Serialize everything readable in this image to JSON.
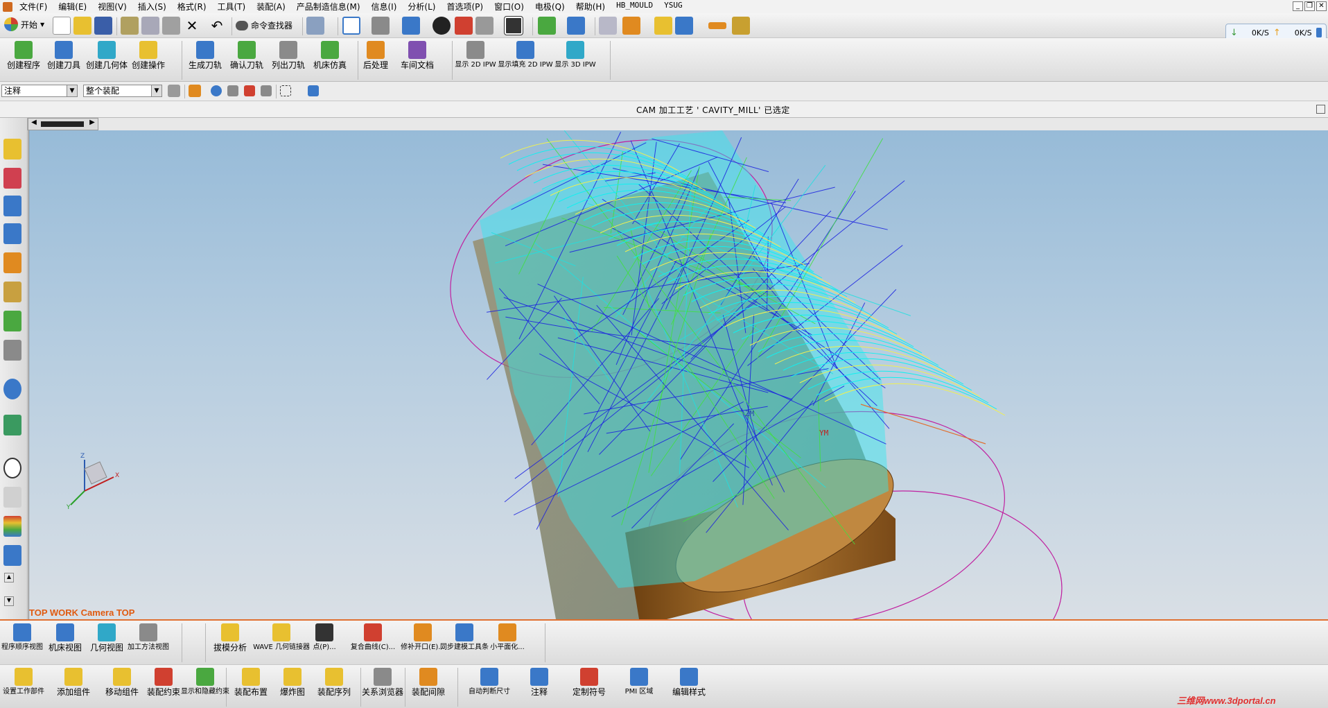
{
  "menu": [
    "文件(F)",
    "编辑(E)",
    "视图(V)",
    "插入(S)",
    "格式(R)",
    "工具(T)",
    "装配(A)",
    "产品制造信息(M)",
    "信息(I)",
    "分析(L)",
    "首选项(P)",
    "窗口(O)",
    "电极(Q)",
    "帮助(H)",
    "HB_MOULD",
    "YSUG"
  ],
  "toolbar1": {
    "start": "开始",
    "command_finder": "命令查找器"
  },
  "network": {
    "down": "0K/S",
    "up": "0K/S"
  },
  "toolbar2": [
    {
      "label": "创建程序",
      "icon": "create-program-icon",
      "color": "#4aa840"
    },
    {
      "label": "创建刀具",
      "icon": "create-tool-icon",
      "color": "#3a78c8"
    },
    {
      "label": "创建几何体",
      "icon": "create-geometry-icon",
      "color": "#30a8c8"
    },
    {
      "label": "创建操作",
      "icon": "create-operation-icon",
      "color": "#e8c030"
    },
    {
      "label": "生成刀轨",
      "icon": "generate-toolpath-icon",
      "color": "#3a78c8"
    },
    {
      "label": "确认刀轨",
      "icon": "verify-toolpath-icon",
      "color": "#4aa840"
    },
    {
      "label": "列出刀轨",
      "icon": "list-toolpath-icon",
      "color": "#8a8a8a"
    },
    {
      "label": "机床仿真",
      "icon": "machine-simulation-icon",
      "color": "#4aa840"
    },
    {
      "label": "后处理",
      "icon": "post-process-icon",
      "color": "#e08a20"
    },
    {
      "label": "车间文档",
      "icon": "shop-doc-icon",
      "color": "#8050b0"
    },
    {
      "label": "显示 2D IPW",
      "icon": "display-2d-ipw-icon",
      "color": "#8a8a8a"
    },
    {
      "label": "显示填充 2D IPW",
      "icon": "display-fill-2d-ipw-icon",
      "color": "#3a78c8"
    },
    {
      "label": "显示 3D IPW",
      "icon": "display-3d-ipw-icon",
      "color": "#30a8c8"
    }
  ],
  "filters": {
    "type_filter": "注释",
    "scope_filter": "整个装配"
  },
  "status_text": "CAM 加工工艺 ' CAVITY_MILL' 已选定",
  "viewport_label": "TOP WORK Camera TOP",
  "triad": {
    "x": "X",
    "y": "Y",
    "z": "Z"
  },
  "toolbar4": [
    {
      "label": "程序顺序视图",
      "icon": "program-order-view-icon",
      "color": "#3a78c8"
    },
    {
      "label": "机床视图",
      "icon": "machine-tool-view-icon",
      "color": "#3a78c8"
    },
    {
      "label": "几何视图",
      "icon": "geometry-view-icon",
      "color": "#30a8c8"
    },
    {
      "label": "加工方法视图",
      "icon": "machining-method-view-icon",
      "color": "#8a8a8a"
    },
    {
      "label": "拔模分析",
      "icon": "draft-analysis-icon",
      "color": "#e8c030"
    },
    {
      "label": "WAVE 几何链接器",
      "icon": "wave-linker-icon",
      "color": "#e8c030"
    },
    {
      "label": "点(P)...",
      "icon": "point-icon",
      "color": "#333333"
    },
    {
      "label": "复合曲线(C)...",
      "icon": "composite-curve-icon",
      "color": "#d04030"
    },
    {
      "label": "修补开口(E)...",
      "icon": "patch-openings-icon",
      "color": "#e08a20"
    },
    {
      "label": "同步建模工具条",
      "icon": "sync-modeling-icon",
      "color": "#3a78c8"
    },
    {
      "label": "小平面化...",
      "icon": "facet-icon",
      "color": "#e08a20"
    }
  ],
  "toolbar5": [
    {
      "label": "设置工作部件",
      "icon": "set-work-part-icon",
      "color": "#e8c030"
    },
    {
      "label": "添加组件",
      "icon": "add-component-icon",
      "color": "#e8c030"
    },
    {
      "label": "移动组件",
      "icon": "move-component-icon",
      "color": "#e8c030"
    },
    {
      "label": "装配约束",
      "icon": "assembly-constraint-icon",
      "color": "#d04030"
    },
    {
      "label": "显示和隐藏约束",
      "icon": "show-hide-constraint-icon",
      "color": "#4aa840"
    },
    {
      "label": "装配布置",
      "icon": "assembly-arrangement-icon",
      "color": "#e8c030"
    },
    {
      "label": "爆炸图",
      "icon": "exploded-view-icon",
      "color": "#e8c030"
    },
    {
      "label": "装配序列",
      "icon": "assembly-sequence-icon",
      "color": "#e8c030"
    },
    {
      "label": "关系浏览器",
      "icon": "relationship-browser-icon",
      "color": "#8a8a8a"
    },
    {
      "label": "装配间隙",
      "icon": "assembly-clearance-icon",
      "color": "#e08a20"
    },
    {
      "label": "自动判断尺寸",
      "icon": "inferred-dimension-icon",
      "color": "#3a78c8"
    },
    {
      "label": "注释",
      "icon": "annotation-icon",
      "color": "#3a78c8"
    },
    {
      "label": "定制符号",
      "icon": "custom-symbol-icon",
      "color": "#d04030"
    },
    {
      "label": "PMI 区域",
      "icon": "pmi-region-icon",
      "color": "#3a78c8"
    },
    {
      "label": "编辑样式",
      "icon": "edit-style-icon",
      "color": "#3a78c8"
    }
  ],
  "watermark": "三维网www.3dportal.cn"
}
